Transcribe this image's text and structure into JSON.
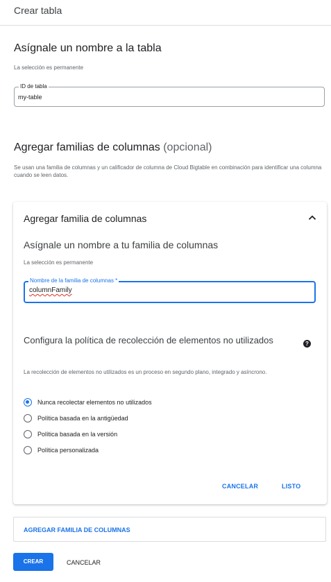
{
  "header": {
    "title": "Crear tabla"
  },
  "name_section": {
    "heading": "Asígnale un nombre a la tabla",
    "subtitle": "La selección es permanente",
    "table_id_label": "ID de tabla",
    "table_id_value": "my-table"
  },
  "families_section": {
    "heading": "Agregar familias de columnas",
    "heading_optional": "(opcional)",
    "description": "Se usan una familia de columnas y un calificador de columna de Cloud Bigtable en combinación para identificar una columna cuando se leen datos."
  },
  "family_card": {
    "title": "Agregar familia de columnas",
    "name_heading": "Asígnale un nombre a tu familia de columnas",
    "name_subtitle": "La selección es permanente",
    "name_label": "Nombre de la familia de columnas *",
    "name_value": "columnFamily",
    "gc_heading": "Configura la política de recolección de elementos no utilizados",
    "gc_description": "La recolección de elementos no utilizados es un proceso en segundo plano, integrado y asíncrono.",
    "gc_options": [
      {
        "label": "Nunca recolectar elementos no utilizados",
        "selected": true
      },
      {
        "label": "Política basada en la antigüedad",
        "selected": false
      },
      {
        "label": "Política basada en la versión",
        "selected": false
      },
      {
        "label": "Política personalizada",
        "selected": false
      }
    ],
    "cancel_label": "CANCELAR",
    "done_label": "LISTO"
  },
  "add_family_label": "AGREGAR FAMILIA DE COLUMNAS",
  "footer": {
    "create_label": "CREAR",
    "cancel_label": "CANCELAR"
  },
  "colors": {
    "accent": "#1a73e8",
    "text": "#202124",
    "secondary": "#5f6368"
  }
}
